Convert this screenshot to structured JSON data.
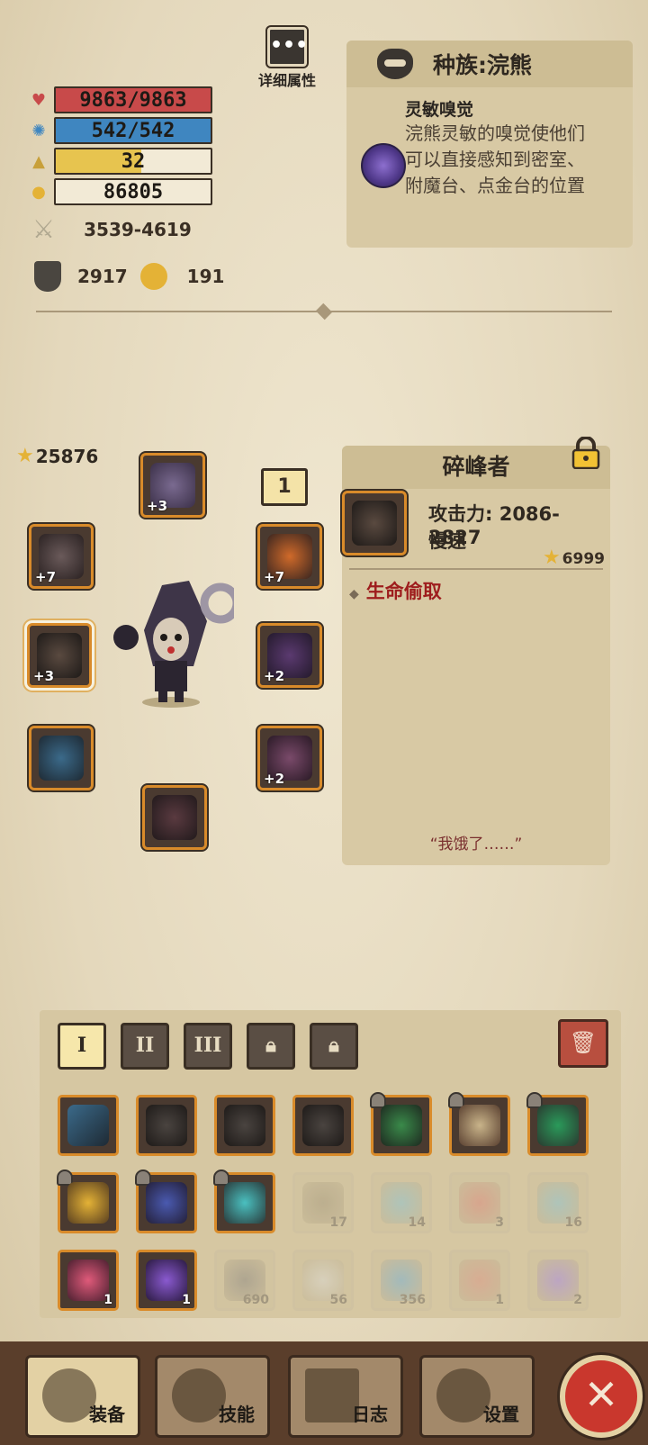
{
  "stats": {
    "hp": "9863/9863",
    "mp": "542/542",
    "level": "32",
    "gold": "86805",
    "attack": "3539-4619",
    "armor": "2917",
    "magic_resist": "191",
    "hp_fill": 1.0,
    "mp_fill": 1.0,
    "level_fill": 0.55,
    "colors": {
      "hp": "#c84a4a",
      "mp": "#3f86c0",
      "level": "#e7c44f"
    }
  },
  "detail": {
    "label": "详细属性",
    "icon": "ellipsis-icon"
  },
  "race": {
    "title": "种族:浣熊",
    "ability_name": "灵敏嗅觉",
    "ability_desc": "浣熊灵敏的嗅觉使他们可以直接感知到密室、附魔台、点金台的位置"
  },
  "equipment": {
    "power": "25876",
    "level_tag": "1",
    "slots": [
      {
        "name": "helmet",
        "level": "+3"
      },
      {
        "name": "shoulder",
        "level": "+7"
      },
      {
        "name": "gloves",
        "level": "+7"
      },
      {
        "name": "weapon",
        "level": "+3"
      },
      {
        "name": "armor",
        "level": "+2"
      },
      {
        "name": "legs",
        "level": ""
      },
      {
        "name": "cape",
        "level": "+2"
      },
      {
        "name": "boots",
        "level": ""
      }
    ]
  },
  "item": {
    "name": "碎峰者",
    "attack": "攻击力: 2086-2827",
    "speed": "慢速",
    "score": "6999",
    "trait": "生命偷取",
    "quote": "“我饿了……”"
  },
  "inventory": {
    "tabs": [
      "I",
      "II",
      "III"
    ],
    "counts": [
      "17",
      "14",
      "3",
      "16",
      "1",
      "1",
      "690",
      "56",
      "356",
      "1",
      "2"
    ]
  },
  "nav": {
    "equipment": "装备",
    "skills": "技能",
    "log": "日志",
    "settings": "设置",
    "close": "✕"
  }
}
